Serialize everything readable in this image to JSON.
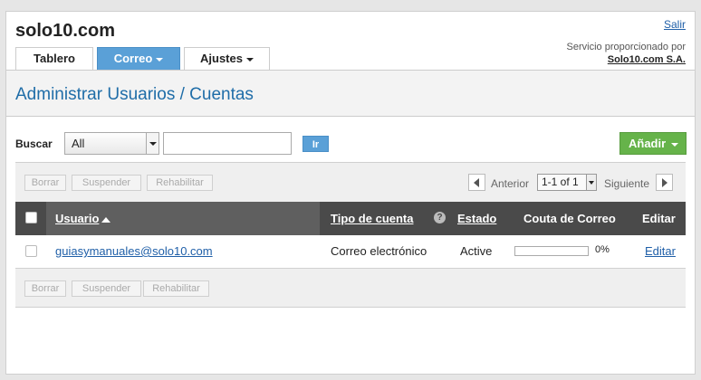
{
  "header": {
    "brand": "solo10.com",
    "logout": "Salir",
    "provided_by": "Servicio proporcionado por",
    "company": "Solo10.com S.A."
  },
  "tabs": [
    {
      "label": "Tablero",
      "active": false
    },
    {
      "label": "Correo",
      "active": true,
      "dropdown": true
    },
    {
      "label": "Ajustes",
      "active": false,
      "dropdown": true
    }
  ],
  "page": {
    "title": "Administrar Usuarios / Cuentas"
  },
  "search": {
    "label": "Buscar",
    "filter_value": "All",
    "query": "",
    "go_label": "Ir"
  },
  "add_button": {
    "label": "Añadir"
  },
  "actions": {
    "delete": "Borrar",
    "suspend": "Suspender",
    "reactivate": "Rehabilitar"
  },
  "pager": {
    "prev": "Anterior",
    "next": "Siguiente",
    "current": "1-1 of 1"
  },
  "table": {
    "columns": {
      "user": "Usuario",
      "type": "Tipo de cuenta",
      "status": "Estado",
      "quota": "Couta de Correo",
      "edit": "Editar"
    },
    "rows": [
      {
        "user": "guiasymanuales@solo10.com",
        "type": "Correo electrónico",
        "status": "Active",
        "quota_percent": 0,
        "quota_label": "0%",
        "edit": "Editar"
      }
    ]
  },
  "colors": {
    "accent": "#5aa0d7",
    "add": "#66b34a",
    "header_dark": "#4a4a4a",
    "title": "#1f6da8"
  },
  "icons": {
    "help": "question-circle-icon",
    "sort": "sort-ascending-icon",
    "prev": "chevron-left-icon",
    "next": "chevron-right-icon"
  }
}
